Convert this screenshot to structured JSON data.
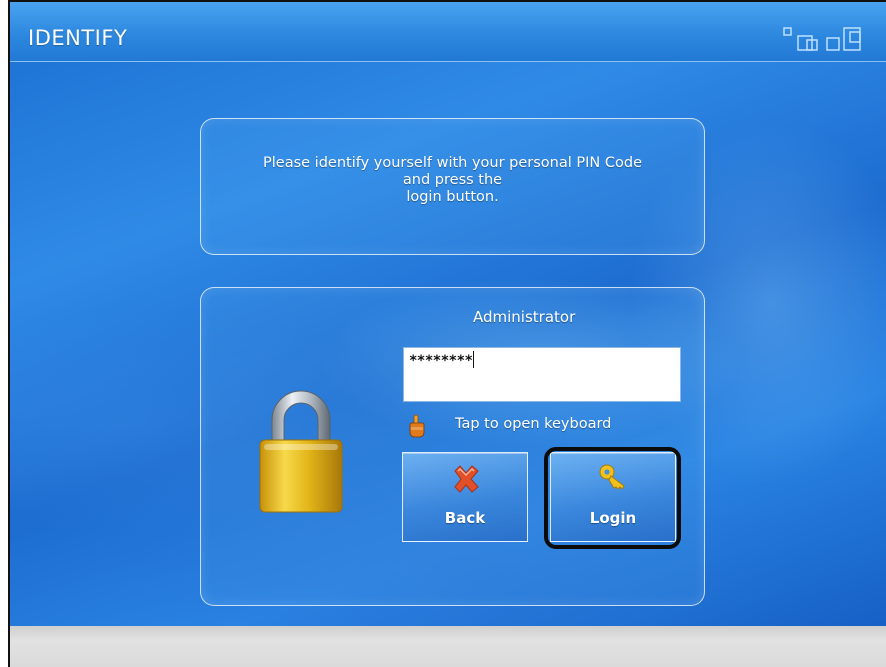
{
  "window": {
    "title": "IDENTIFY"
  },
  "message": {
    "line1": "Please identify yourself with your personal PIN Code",
    "line2": "and press the",
    "line3": "login button."
  },
  "login": {
    "username": "Administrator",
    "pin_value": "********",
    "tap_hint": "Tap to open keyboard"
  },
  "buttons": {
    "back_label": "Back",
    "login_label": "Login"
  },
  "icons": {
    "lock": "padlock-icon",
    "tap": "pointing-hand-icon",
    "back": "red-x-icon",
    "login": "key-icon"
  },
  "colors": {
    "background_blue": "#2f8ae6",
    "titlebar_blue": "#2d88df",
    "text": "#ffffff",
    "lock_gold": "#e2b418",
    "back_red": "#e2502a",
    "key_gold": "#f2c21c",
    "focus_ring": "#0b0b0b"
  }
}
